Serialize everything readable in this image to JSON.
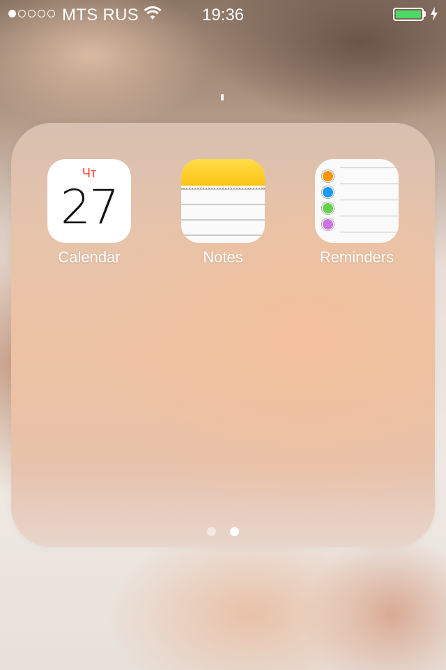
{
  "status_bar": {
    "signal_dots_filled": 1,
    "signal_dots_total": 5,
    "carrier": "MTS RUS",
    "time": "19:36",
    "battery_level": 1.0,
    "battery_color": "#4cd964",
    "icons": [
      "wifi-icon",
      "battery-icon",
      "charging-bolt-icon"
    ]
  },
  "folder": {
    "apps": [
      {
        "name": "Calendar",
        "icon": "calendar-icon",
        "day_label": "Чт",
        "date": "27"
      },
      {
        "name": "Notes",
        "icon": "notes-icon"
      },
      {
        "name": "Reminders",
        "icon": "reminders-icon",
        "dot_colors": [
          "#ff9500",
          "#1a9cf5",
          "#64d24a",
          "#cc73e1"
        ]
      }
    ],
    "pages_total": 2,
    "current_page": 2
  }
}
